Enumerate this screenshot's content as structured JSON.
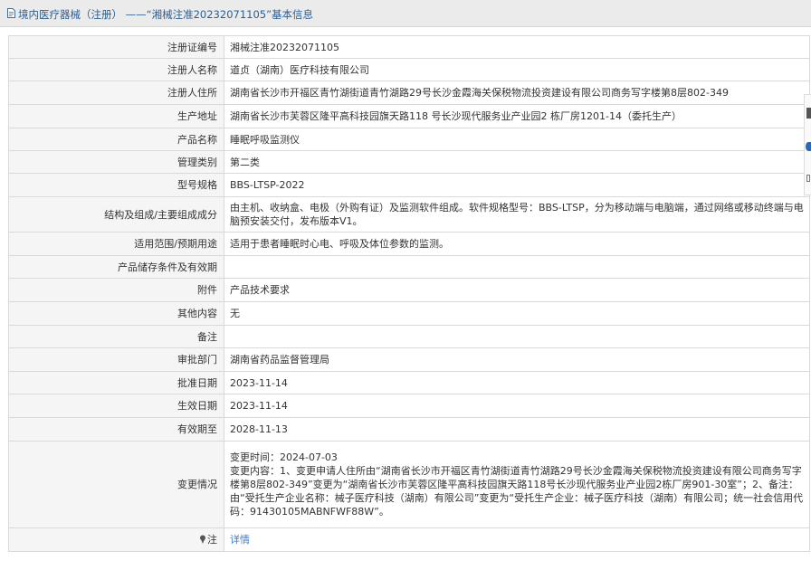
{
  "title": "境内医疗器械（注册） ——“湘械注准20232071105”基本信息",
  "rows": [
    {
      "label": "注册证编号",
      "value": [
        "湘械注准20232071105"
      ]
    },
    {
      "label": "注册人名称",
      "value": [
        "道贞（湖南）医疗科技有限公司"
      ]
    },
    {
      "label": "注册人住所",
      "value": [
        "湖南省长沙市开福区青竹湖街道青竹湖路29号长沙金霞海关保税物流投资建设有限公司商务写字楼第8层802-349"
      ]
    },
    {
      "label": "生产地址",
      "value": [
        "湖南省长沙市芙蓉区隆平高科技园旗天路118 号长沙现代服务业产业园2 栋厂房1201-14（委托生产）"
      ]
    },
    {
      "label": "产品名称",
      "value": [
        "睡眠呼吸监测仪"
      ]
    },
    {
      "label": "管理类别",
      "value": [
        "第二类"
      ]
    },
    {
      "label": "型号规格",
      "value": [
        "BBS-LTSP-2022"
      ]
    },
    {
      "label": "结构及组成/主要组成成分",
      "value": [
        "由主机、收纳盒、电极（外购有证）及监测软件组成。软件规格型号：BBS-LTSP，分为移动端与电脑端，通过网络或移动终端与电脑预安装交付，发布版本V1。"
      ]
    },
    {
      "label": "适用范围/预期用途",
      "value": [
        "适用于患者睡眠时心电、呼吸及体位参数的监测。"
      ]
    },
    {
      "label": "产品储存条件及有效期",
      "value": [
        ""
      ]
    },
    {
      "label": "附件",
      "value": [
        "产品技术要求"
      ]
    },
    {
      "label": "其他内容",
      "value": [
        "无"
      ]
    },
    {
      "label": "备注",
      "value": [
        ""
      ]
    },
    {
      "label": "审批部门",
      "value": [
        "湖南省药品监督管理局"
      ]
    },
    {
      "label": "批准日期",
      "value": [
        "2023-11-14"
      ]
    },
    {
      "label": "生效日期",
      "value": [
        "2023-11-14"
      ]
    },
    {
      "label": "有效期至",
      "value": [
        "2028-11-13"
      ]
    },
    {
      "label": "变更情况",
      "value": [
        "变更时间：2024-07-03",
        "变更内容：1、变更申请人住所由“湖南省长沙市开福区青竹湖街道青竹湖路29号长沙金霞海关保税物流投资建设有限公司商务写字楼第8层802-349”变更为“湖南省长沙市芙蓉区隆平高科技园旗天路118号长沙现代服务业产业园2栋厂房901-30室”；2、备注：由“受托生产企业名称：械子医疗科技（湖南）有限公司”变更为“受托生产企业：械子医疗科技（湖南）有限公司；统一社会信用代码：91430105MABNFWF88W”。"
      ]
    }
  ],
  "note": {
    "label": "注",
    "link": "详情"
  }
}
